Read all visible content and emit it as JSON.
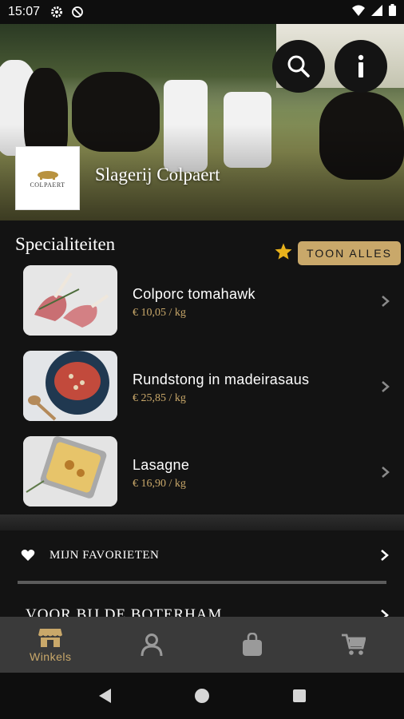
{
  "status_bar": {
    "time": "15:07"
  },
  "hero": {
    "shop_name": "Slagerij Colpaert",
    "logo_text": "COLPAERT"
  },
  "specials": {
    "title": "Specialiteiten",
    "show_all_label": "TOON ALLES",
    "items": [
      {
        "name": "Colporc tomahawk",
        "price": "€ 10,05 / kg"
      },
      {
        "name": "Rundstong in madeirasaus",
        "price": "€ 25,85 / kg"
      },
      {
        "name": "Lasagne",
        "price": "€ 16,90 / kg"
      }
    ]
  },
  "menu": {
    "favorites_label": "MIJN FAVORIETEN",
    "next_label": "VOOR BIJ DE BOTERHAM"
  },
  "tabbar": {
    "tabs": [
      {
        "label": "Winkels",
        "icon": "store-icon",
        "active": true
      },
      {
        "label": "",
        "icon": "person-icon",
        "active": false
      },
      {
        "label": "",
        "icon": "bag-icon",
        "active": false
      },
      {
        "label": "",
        "icon": "cart-icon",
        "active": false
      }
    ]
  },
  "colors": {
    "accent": "#c9a86a",
    "background": "#131313",
    "tabbar": "#3a3a3a"
  }
}
